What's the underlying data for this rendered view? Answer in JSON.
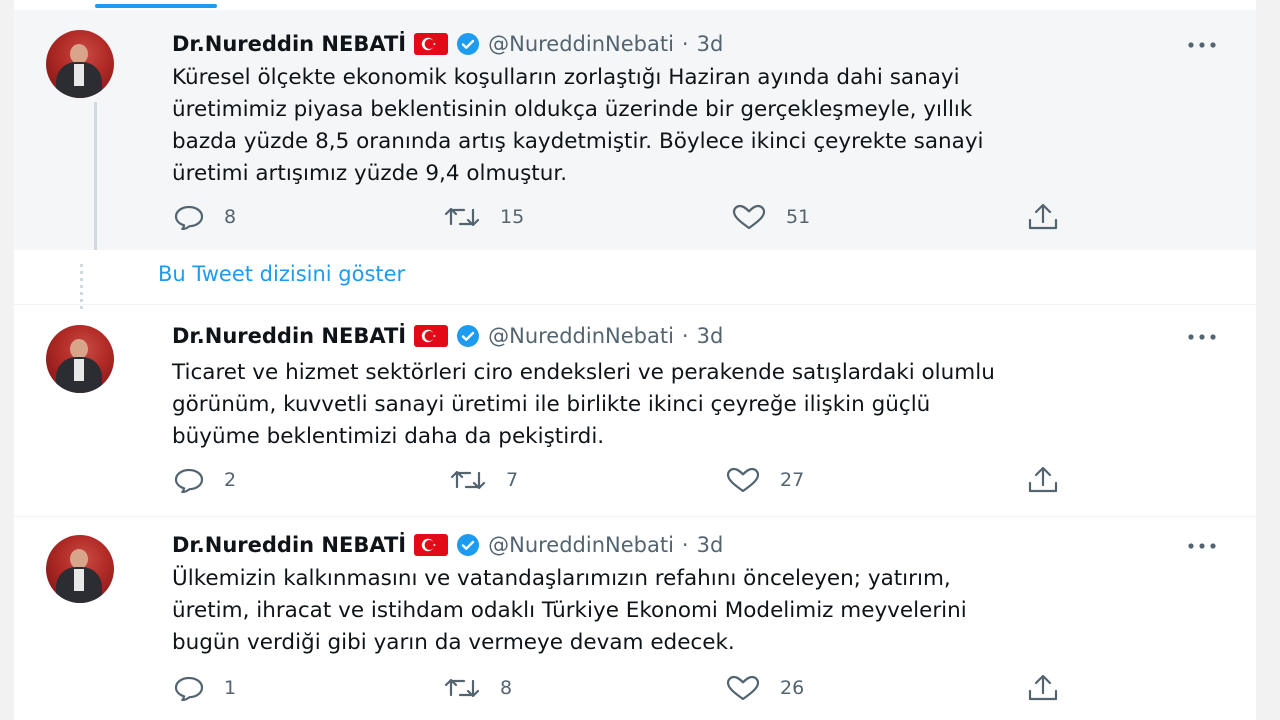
{
  "colors": {
    "accent": "#1d9bf0",
    "text": "#0f1419",
    "muted": "#536471",
    "flag_red": "#e30a17"
  },
  "show_thread_label": "Bu Tweet dizisini göster",
  "tweets": [
    {
      "author_name": "Dr.Nureddin NEBATİ",
      "handle": "@NureddinNebati",
      "separator": "·",
      "time": "3d",
      "lines": [
        "Küresel ölçekte ekonomik koşulların zorlaştığı Haziran ayında dahi sanayi",
        "üretimimiz piyasa beklentisinin oldukça üzerinde bir gerçekleşmeyle, yıllık",
        "bazda yüzde 8,5 oranında artış kaydetmiştir. Böylece ikinci çeyrekte sanayi",
        "üretimi artışımız yüzde 9,4 olmuştur."
      ],
      "replies": "8",
      "retweets": "15",
      "likes": "51"
    },
    {
      "author_name": "Dr.Nureddin NEBATİ",
      "handle": "@NureddinNebati",
      "separator": "·",
      "time": "3d",
      "lines": [
        "Ticaret ve hizmet sektörleri ciro endeksleri ve perakende satışlardaki olumlu",
        "görünüm, kuvvetli sanayi üretimi ile birlikte ikinci çeyreğe ilişkin güçlü",
        "büyüme beklentimizi daha da pekiştirdi."
      ],
      "replies": "2",
      "retweets": "7",
      "likes": "27"
    },
    {
      "author_name": "Dr.Nureddin NEBATİ",
      "handle": "@NureddinNebati",
      "separator": "·",
      "time": "3d",
      "lines": [
        "Ülkemizin kalkınmasını ve vatandaşlarımızın refahını önceleyen; yatırım,",
        "üretim, ihracat ve istihdam odaklı Türkiye Ekonomi Modelimiz meyvelerini",
        "bugün verdiği gibi yarın da vermeye devam edecek."
      ],
      "replies": "1",
      "retweets": "8",
      "likes": "26"
    }
  ]
}
